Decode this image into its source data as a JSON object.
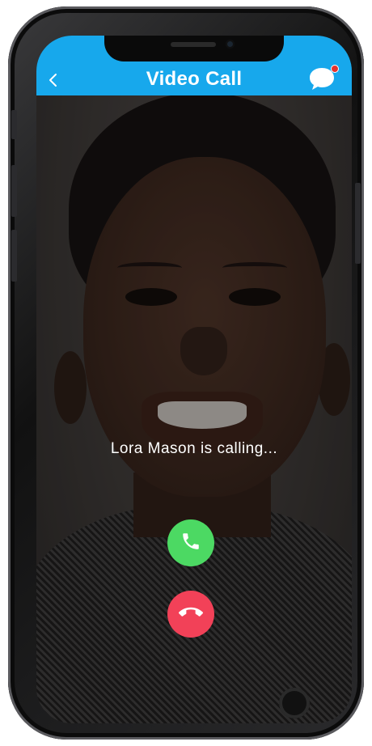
{
  "nav": {
    "title": "Video Call",
    "back_icon": "chevron-left-icon",
    "chat_icon": "chat-bubble-icon"
  },
  "call": {
    "status_text": "Lora Mason is calling...",
    "accept_icon": "phone-icon",
    "decline_icon": "phone-hangup-icon"
  },
  "colors": {
    "navbar": "#17a8ec",
    "accept": "#4cd963",
    "decline": "#f24158",
    "notification_dot": "#e5322d"
  }
}
